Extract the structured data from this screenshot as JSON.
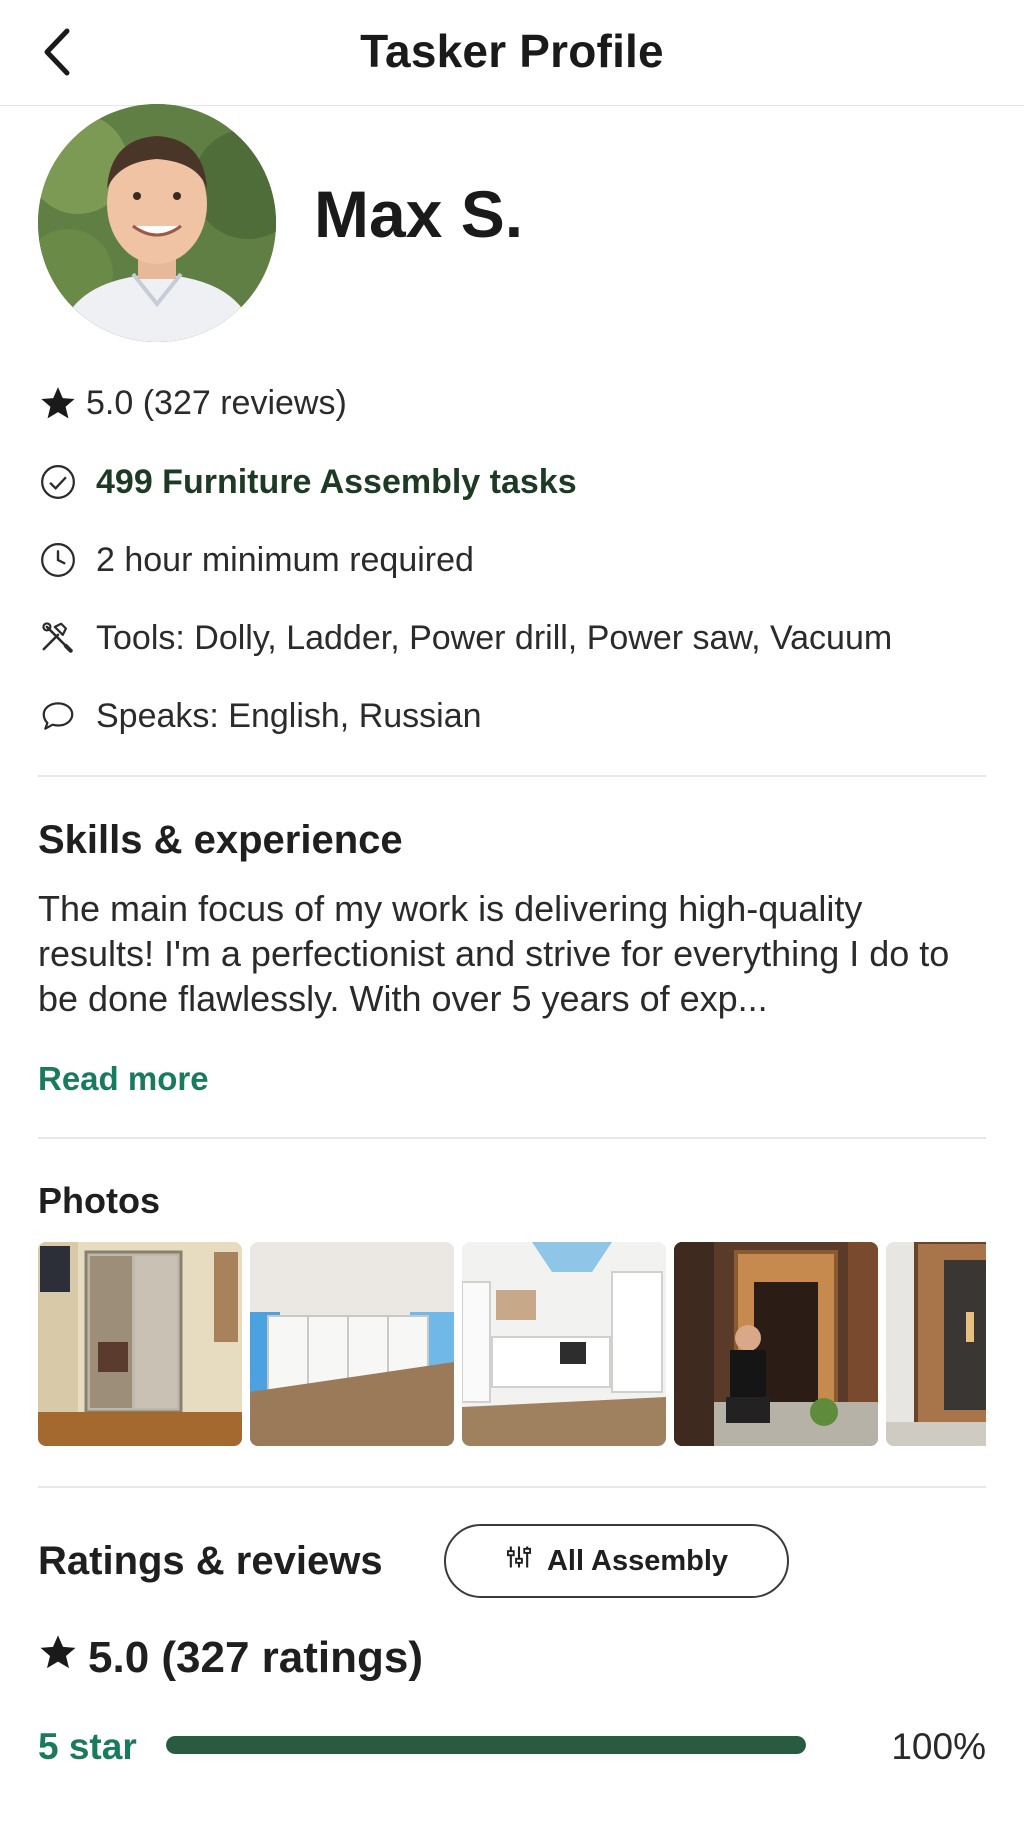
{
  "header": {
    "title": "Tasker Profile"
  },
  "profile": {
    "name": "Max S.",
    "rating_line": "5.0 (327 reviews)",
    "tasks_line": "499 Furniture Assembly tasks",
    "minimum_line": "2 hour minimum required",
    "tools_line": "Tools: Dolly, Ladder, Power drill, Power saw, Vacuum",
    "languages_line": "Speaks: English, Russian"
  },
  "skills": {
    "title": "Skills & experience",
    "text": "The main focus of my work is delivering high-quality results! I'm a perfectionist and strive for everything I do to be done flawlessly. With over 5 years of exp...",
    "read_more": "Read more"
  },
  "photos": {
    "title": "Photos",
    "items": [
      "closet-mirror-doors",
      "kitchen-cabinets-lower",
      "kitchen-full",
      "tasker-with-sauna",
      "sauna-cabinet"
    ]
  },
  "reviews": {
    "title": "Ratings & reviews",
    "filter_label": "All Assembly",
    "summary": "5.0 (327 ratings)",
    "distribution": [
      {
        "label": "5 star",
        "percent_text": "100%",
        "fraction": 1.0
      }
    ]
  },
  "colors": {
    "accent_green": "#1a7a5e",
    "dark_green": "#2a5a40",
    "task_green": "#1d3b24"
  }
}
